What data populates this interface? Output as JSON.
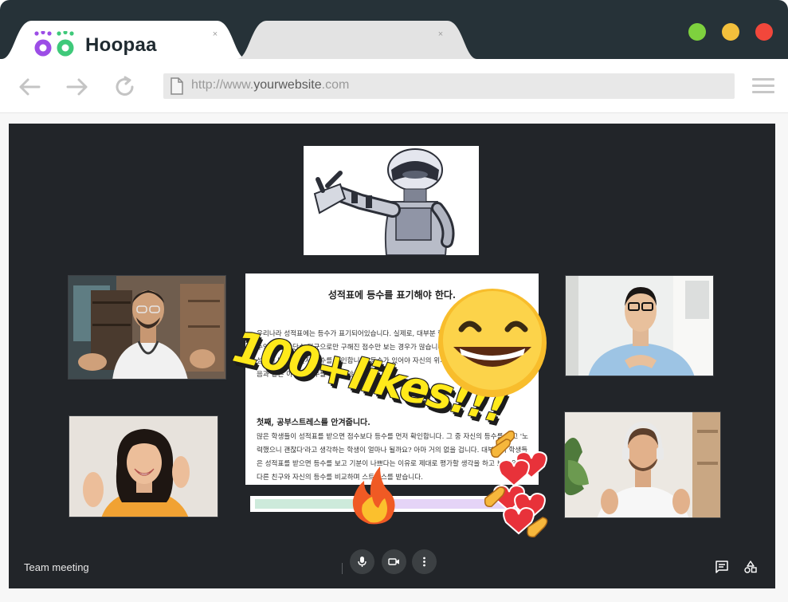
{
  "browser": {
    "active_tab": {
      "title": "Hoopaa",
      "close": "×"
    },
    "inactive_tab": {
      "close": "×"
    },
    "address": {
      "prefix": "http://www.",
      "domain": "yourwebsite",
      "suffix": ".com"
    },
    "colors": {
      "titlebar": "#263238",
      "green": "#7ed13e",
      "yellow": "#f3c03c",
      "red": "#f2473b"
    }
  },
  "meeting": {
    "name": "Team meeting",
    "document": {
      "title": "성적표에 등수를 표기해야 한다.",
      "paragraph1": "우리나라 성적표에는 등수가 표기되어있습니다. 실제로, 대부분 학생이 성적표를 보면 수가 갈 등수인데 반해 단순 평균으로만 구해진 점수만 보는 경우가 많습니다. 얼마나 잘 했는지 알기 위해 성적을 받으면 먼저 등수를 확인합니다. 등수가 있어야 자신의 위치를 알 수 있습니다. 하지만 다음과 같은 이유로 등수를 표기해야 합니다.",
      "heading2": "첫째, 공부스트레스를 안겨줍니다.",
      "paragraph2": "많은 학생들이 성적표를 받으면 점수보다 등수를 먼저 확인합니다. 그 중 자신의 등수를 보고 '노력했으니 괜찮다'라고 생각하는 학생이 얼마나 될까요? 아마 거의 없을 겁니다. 대부분의 학생들은 성적표를 받으면 등수를 보고 기분이 나쁘다는 이유로 제대로 평가할 생각을 하고 보지 않거나, 다른 친구와 자신의 등수를 비교하며 스트레스를 받습니다."
    },
    "reaction_text": "100+likes!!!",
    "progress": {
      "segment_a_percent": 36,
      "segment_b_percent": 60
    },
    "participants": [
      {
        "name": "robot-presenter"
      },
      {
        "name": "doctor"
      },
      {
        "name": "woman-waving"
      },
      {
        "name": "man-glasses"
      },
      {
        "name": "man-headphones"
      }
    ]
  }
}
